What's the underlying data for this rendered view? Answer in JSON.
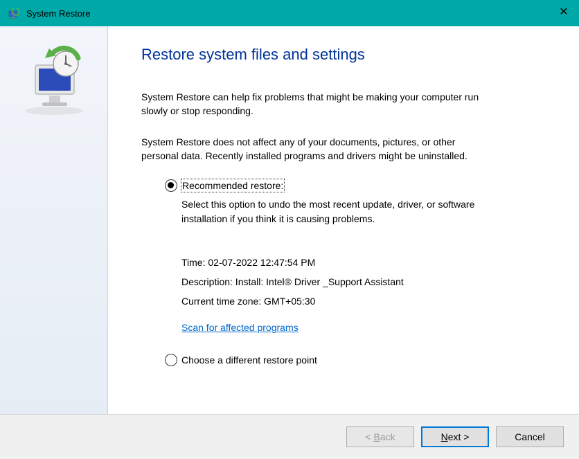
{
  "titlebar": {
    "title": "System Restore"
  },
  "main": {
    "heading": "Restore system files and settings",
    "para1": "System Restore can help fix problems that might be making your computer run slowly or stop responding.",
    "para2": "System Restore does not affect any of your documents, pictures, or other personal data. Recently installed programs and drivers might be uninstalled.",
    "option1_label": "Recommended restore:",
    "option1_desc": "Select this option to undo the most recent update, driver, or software installation if you think it is causing problems.",
    "detail_time": "Time: 02-07-2022 12:47:54 PM",
    "detail_desc": "Description: Install: Intel® Driver _Support Assistant",
    "detail_tz": "Current time zone: GMT+05:30",
    "scan_link": "Scan for affected programs",
    "option2_label": "Choose a different restore point"
  },
  "footer": {
    "back": "< Back",
    "next": "Next >",
    "cancel": "Cancel"
  }
}
